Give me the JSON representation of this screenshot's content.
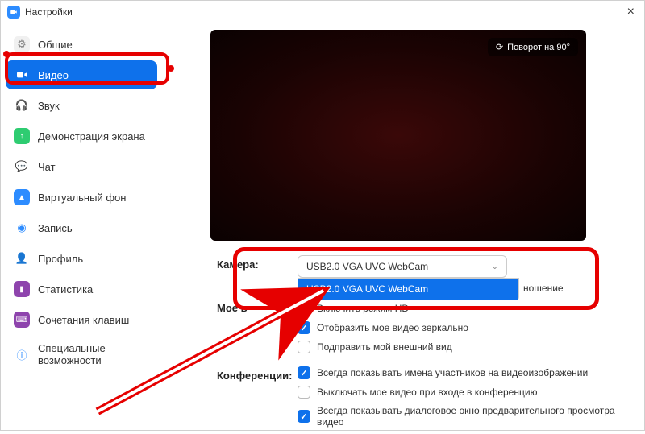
{
  "title": "Настройки",
  "close_label": "×",
  "rotate_label": "Поворот на 90°",
  "sidebar": {
    "items": [
      {
        "label": "Общие"
      },
      {
        "label": "Видео"
      },
      {
        "label": "Звук"
      },
      {
        "label": "Демонстрация экрана"
      },
      {
        "label": "Чат"
      },
      {
        "label": "Виртуальный фон"
      },
      {
        "label": "Запись"
      },
      {
        "label": "Профиль"
      },
      {
        "label": "Статистика"
      },
      {
        "label": "Сочетания клавиш"
      },
      {
        "label": "Специальные возможности"
      }
    ]
  },
  "camera": {
    "label": "Камера:",
    "selected": "USB2.0 VGA UVC WebCam",
    "option": "USB2.0 VGA UVC WebCam",
    "ratio_suffix": "ношение"
  },
  "my_video": {
    "label_partial": "Мое в",
    "hd": "Включить режим HD",
    "mirror": "Отобразить мое видео зеркально",
    "touch_up": "Подправить мой внешний вид"
  },
  "meetings": {
    "label": "Конференции:",
    "show_names": "Всегда показывать имена участников на видеоизображении",
    "turn_off": "Выключать мое видео при входе в конференцию",
    "preview_dialog": "Всегда показывать диалоговое окно предварительного просмотра видео"
  }
}
